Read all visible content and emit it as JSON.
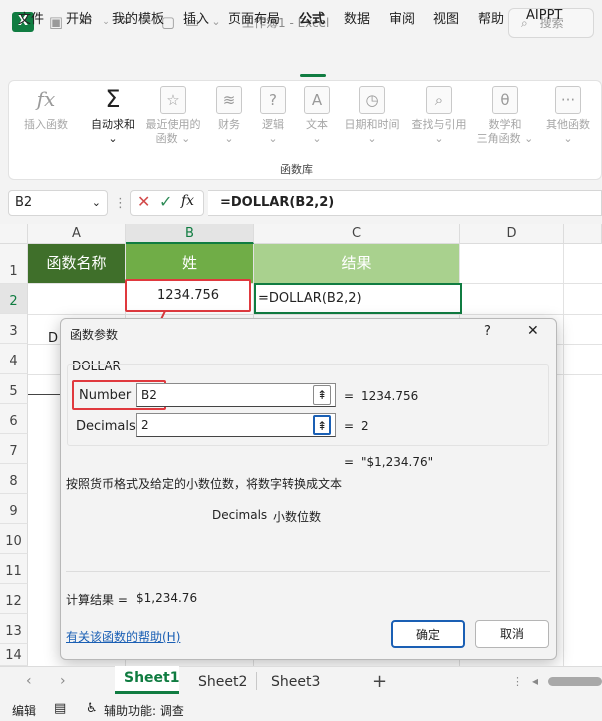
{
  "titlebar": {
    "app_icon": "X",
    "title": "工作簿1 - Excel",
    "search_placeholder": "搜索"
  },
  "menu": {
    "items": [
      "文件",
      "开始",
      "我的模板",
      "插入",
      "页面布局",
      "公式",
      "数据",
      "审阅",
      "视图",
      "帮助",
      "AIPPT"
    ],
    "active": "公式"
  },
  "ribbon": {
    "buttons": [
      {
        "icon": "fx-icon",
        "glyph": "fx",
        "label1": "插入函数",
        "label2": ""
      },
      {
        "icon": "sigma-icon",
        "glyph": "Σ",
        "label1": "自动求和",
        "label2": "⌄"
      },
      {
        "icon": "star-icon",
        "glyph": "☆",
        "label1": "最近使用的",
        "label2": "函数 ⌄"
      },
      {
        "icon": "database-icon",
        "glyph": "≋",
        "label1": "财务",
        "label2": "⌄"
      },
      {
        "icon": "question-icon",
        "glyph": "?",
        "label1": "逻辑",
        "label2": "⌄"
      },
      {
        "icon": "text-a-icon",
        "glyph": "A",
        "label1": "文本",
        "label2": "⌄"
      },
      {
        "icon": "clock-icon",
        "glyph": "◷",
        "label1": "日期和时间",
        "label2": "⌄"
      },
      {
        "icon": "search-icon",
        "glyph": "⌕",
        "label1": "查找与引用",
        "label2": "⌄"
      },
      {
        "icon": "theta-icon",
        "glyph": "θ",
        "label1": "数学和",
        "label2": "三角函数 ⌄"
      },
      {
        "icon": "more-icon",
        "glyph": "···",
        "label1": "其他函数",
        "label2": "⌄"
      }
    ],
    "group_label": "函数库"
  },
  "formula_bar": {
    "name_box": "B2",
    "formula": "=DOLLAR(B2,2)"
  },
  "grid": {
    "columns": [
      "A",
      "B",
      "C",
      "D"
    ],
    "rows": [
      "1",
      "2",
      "3",
      "4",
      "5",
      "6",
      "7",
      "8",
      "9",
      "10",
      "11",
      "12",
      "13",
      "14"
    ],
    "a1": "函数名称",
    "b1": "姓",
    "c1": "结果",
    "b2": "1234.756",
    "c2": "=DOLLAR(B2,2)",
    "a3_partial": "D",
    "header_colors": {
      "a1": "#3f6f2a",
      "b1": "#70ad47",
      "c1": "#a9d18e"
    }
  },
  "dialog": {
    "title": "函数参数",
    "help_glyph": "?",
    "close_glyph": "✕",
    "function_name": "DOLLAR",
    "args": [
      {
        "label": "Number",
        "value": "B2",
        "result": "1234.756"
      },
      {
        "label": "Decimals",
        "value": "2",
        "result": "2"
      }
    ],
    "equals": "=",
    "formula_result": "\"$1,234.76\"",
    "description": "按照货币格式及给定的小数位数，将数字转换成文本",
    "param_name": "Decimals",
    "param_desc": "小数位数",
    "calc_result_label": "计算结果 =",
    "calc_result_value": "$1,234.76",
    "help_link": "有关该函数的帮助(H)",
    "ok_label": "确定",
    "cancel_label": "取消"
  },
  "sheets": {
    "tabs": [
      "Sheet1",
      "Sheet2",
      "Sheet3"
    ],
    "active": "Sheet1",
    "add_glyph": "+"
  },
  "status": {
    "mode": "编辑",
    "accessibility": "辅助功能: 调查"
  },
  "colors": {
    "excel_green": "#107c41",
    "annotation_red": "#e0393e"
  }
}
